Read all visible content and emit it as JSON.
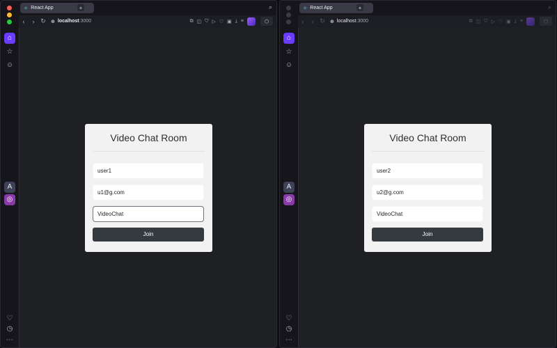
{
  "browser": {
    "tab_title": "React App",
    "url_host": "localhost",
    "url_port": ":3000",
    "icons": [
      "back-icon",
      "forward-icon",
      "reload-icon",
      "globe-icon",
      "screenshot-icon",
      "camera-icon",
      "shield-icon",
      "play-icon",
      "heart-icon",
      "wallet-icon",
      "download-icon",
      "menu-icon",
      "extension-icon",
      "search-icon",
      "home-icon",
      "star-icon",
      "emoji-icon",
      "app-icon",
      "instagram-icon",
      "history-icon",
      "more-icon"
    ]
  },
  "left_app": {
    "title": "Video Chat Room",
    "username": "user1",
    "email": "u1@g.com",
    "room": "VideoChat",
    "join_label": "Join"
  },
  "right_app": {
    "title": "Video Chat Room",
    "username": "user2",
    "email": "u2@g.com",
    "room": "VideoChat",
    "join_label": "Join"
  },
  "colors": {
    "accent": "#6a3cff",
    "page_bg": "#1f2024",
    "card_bg": "#f2f2f2",
    "button_bg": "#343a40"
  }
}
